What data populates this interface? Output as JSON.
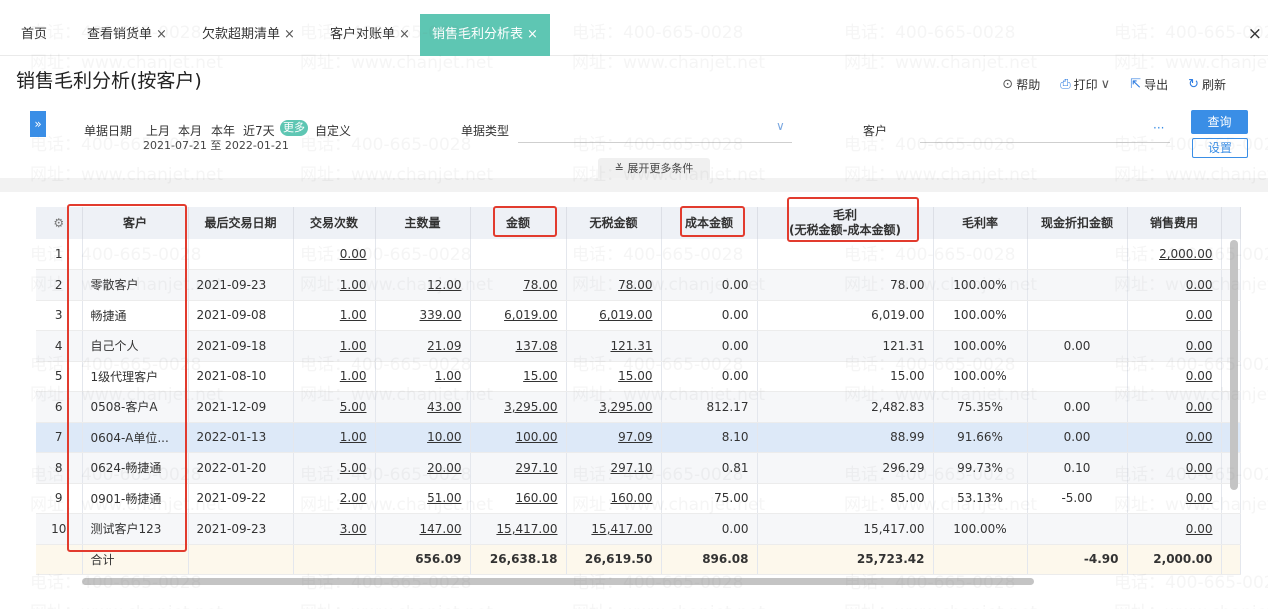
{
  "tabs": [
    {
      "label": "首页",
      "closable": false,
      "active": false
    },
    {
      "label": "查看销货单",
      "closable": true,
      "active": false
    },
    {
      "label": "欠款超期清单",
      "closable": true,
      "active": false
    },
    {
      "label": "客户对账单",
      "closable": true,
      "active": false
    },
    {
      "label": "销售毛利分析表",
      "closable": true,
      "active": true
    }
  ],
  "close_glyph": "×",
  "page_title": "销售毛利分析(按客户)",
  "toolbar": {
    "help": "帮助",
    "print": "打印",
    "export": "导出",
    "refresh": "刷新"
  },
  "filters": {
    "expand_icon": "»",
    "date_label": "单据日期",
    "date_options": [
      "上月",
      "本月",
      "本年",
      "近7天"
    ],
    "more": "更多",
    "custom": "自定义",
    "date_range": "2021-07-21 至 2022-01-21",
    "doc_type_label": "单据类型",
    "customer_label": "客户",
    "customer_dots": "···",
    "query_button": "查询",
    "settings_button": "设置",
    "expand_more": "展开更多条件"
  },
  "table": {
    "settings_icon": "⚙",
    "columns": [
      "客户",
      "最后交易日期",
      "交易次数",
      "主数量",
      "金额",
      "无税金额",
      "成本金额",
      "毛利",
      "毛利率",
      "现金折扣金额",
      "销售费用"
    ],
    "profit_sub": "(无税金额-成本金额)",
    "rows": [
      {
        "no": "1",
        "customer": "",
        "date": "",
        "count": "0.00",
        "qty": "",
        "amount": "",
        "net": "",
        "cost": "",
        "profit": "",
        "rate": "",
        "discount": "",
        "fee": "2,000.00"
      },
      {
        "no": "2",
        "customer": "零散客户",
        "date": "2021-09-23",
        "count": "1.00",
        "qty": "12.00",
        "amount": "78.00",
        "net": "78.00",
        "cost": "0.00",
        "profit": "78.00",
        "rate": "100.00%",
        "discount": "",
        "fee": "0.00"
      },
      {
        "no": "3",
        "customer": "畅捷通",
        "date": "2021-09-08",
        "count": "1.00",
        "qty": "339.00",
        "amount": "6,019.00",
        "net": "6,019.00",
        "cost": "0.00",
        "profit": "6,019.00",
        "rate": "100.00%",
        "discount": "",
        "fee": "0.00"
      },
      {
        "no": "4",
        "customer": "自己个人",
        "date": "2021-09-18",
        "count": "1.00",
        "qty": "21.09",
        "amount": "137.08",
        "net": "121.31",
        "cost": "0.00",
        "profit": "121.31",
        "rate": "100.00%",
        "discount": "0.00",
        "fee": "0.00"
      },
      {
        "no": "5",
        "customer": "1级代理客户",
        "date": "2021-08-10",
        "count": "1.00",
        "qty": "1.00",
        "amount": "15.00",
        "net": "15.00",
        "cost": "0.00",
        "profit": "15.00",
        "rate": "100.00%",
        "discount": "",
        "fee": "0.00"
      },
      {
        "no": "6",
        "customer": "0508-客户A",
        "date": "2021-12-09",
        "count": "5.00",
        "qty": "43.00",
        "amount": "3,295.00",
        "net": "3,295.00",
        "cost": "812.17",
        "profit": "2,482.83",
        "rate": "75.35%",
        "discount": "0.00",
        "fee": "0.00"
      },
      {
        "no": "7",
        "customer": "0604-A单位...",
        "date": "2022-01-13",
        "count": "1.00",
        "qty": "10.00",
        "amount": "100.00",
        "net": "97.09",
        "cost": "8.10",
        "profit": "88.99",
        "rate": "91.66%",
        "discount": "0.00",
        "fee": "0.00"
      },
      {
        "no": "8",
        "customer": "0624-畅捷通",
        "date": "2022-01-20",
        "count": "5.00",
        "qty": "20.00",
        "amount": "297.10",
        "net": "297.10",
        "cost": "0.81",
        "profit": "296.29",
        "rate": "99.73%",
        "discount": "0.10",
        "fee": "0.00"
      },
      {
        "no": "9",
        "customer": "0901-畅捷通",
        "date": "2021-09-22",
        "count": "2.00",
        "qty": "51.00",
        "amount": "160.00",
        "net": "160.00",
        "cost": "75.00",
        "profit": "85.00",
        "rate": "53.13%",
        "discount": "-5.00",
        "fee": "0.00"
      },
      {
        "no": "10",
        "customer": "测试客户123",
        "date": "2021-09-23",
        "count": "3.00",
        "qty": "147.00",
        "amount": "15,417.00",
        "net": "15,417.00",
        "cost": "0.00",
        "profit": "15,417.00",
        "rate": "100.00%",
        "discount": "",
        "fee": "0.00"
      }
    ],
    "total": {
      "label": "合计",
      "qty": "656.09",
      "amount": "26,638.18",
      "net": "26,619.50",
      "cost": "896.08",
      "profit": "25,723.42",
      "discount": "-4.90",
      "fee": "2,000.00"
    }
  },
  "watermark": {
    "phone": "电话：400-665-0028",
    "site": "网址：www.chanjet.net"
  },
  "colors": {
    "accent": "#3a8ee6",
    "tab_active": "#5ec6b3",
    "highlight_box": "#e23b2e",
    "negative": "#e02020"
  }
}
